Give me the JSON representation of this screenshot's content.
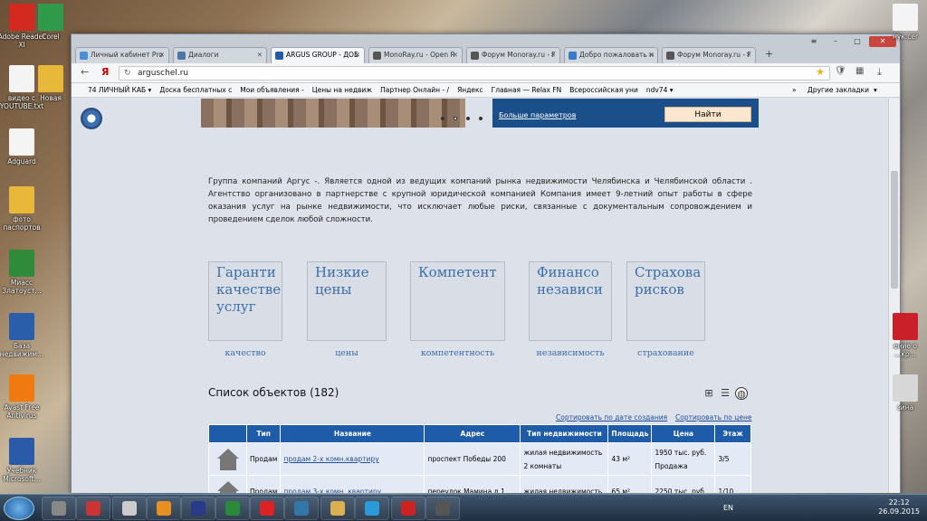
{
  "desktop": {
    "icons_left": [
      {
        "label": "Adobe Reader XI",
        "color": "#d32a1f"
      },
      {
        "label": "видео с YOUTUBE.txt",
        "color": "#f4f4f4"
      },
      {
        "label": "Adguard",
        "color": "#f4f4f4"
      },
      {
        "label": "фото паспортов",
        "color": "#e8b83a"
      },
      {
        "label": "Миасс Златоуст...",
        "color": "#2f8a3a"
      },
      {
        "label": "База недвижим...",
        "color": "#2a5ea8"
      },
      {
        "label": "Avast Free Antivirus",
        "color": "#f07a12"
      },
      {
        "label": "Учебник Microsoft...",
        "color": "#2b5aa8"
      }
    ],
    "icons_col2": [
      {
        "label": "Corel",
        "color": "#2f9a4a"
      },
      {
        "label": "Новая",
        "color": "#e8b83a"
      }
    ],
    "icons_right": [
      {
        "label": "нук.cer",
        "color": "#f4f4f4"
      },
      {
        "label": "ение о ...кр...",
        "color": "#c9202a"
      },
      {
        "label": "зина",
        "color": "#d7d7d7"
      }
    ]
  },
  "browser": {
    "tabs": [
      {
        "label": "Личный кабинет Pro",
        "color": "#4a8fd8",
        "active": false
      },
      {
        "label": "Диалоги",
        "color": "#4a76a8",
        "active": false
      },
      {
        "label": "ARGUS GROUP - ДОБ",
        "color": "#1e5ba8",
        "active": true
      },
      {
        "label": "MonoRay.ru - Open R",
        "color": "#555555",
        "active": false
      },
      {
        "label": "Форум Monoray.ru - F",
        "color": "#555555",
        "active": false
      },
      {
        "label": "Добро пожаловать н",
        "color": "#3a7ac8",
        "active": false
      },
      {
        "label": "Форум Monoray.ru - F",
        "color": "#555555",
        "active": false
      }
    ],
    "tab_close": "✕",
    "new_tab": "+",
    "window_buttons": {
      "menu": "≡",
      "minimize": "–",
      "maximize": "□",
      "close": "✕"
    },
    "address": "arguschel.ru",
    "yandex_label": "Я",
    "bookmarks": [
      "74 ЛИЧНЫЙ КАБ ▾",
      "Доска бесплатных с",
      "Мои объявления -",
      "Цены на недвиж",
      "Партнер Онлайн - /",
      "Яндекс",
      "Главная — Relax FN",
      "Всероссийская уни",
      "ndv74 ▾"
    ],
    "bookmarks_more": "»",
    "other_bookmarks": "Другие закладки",
    "other_bookmarks_arrow": "▾"
  },
  "page": {
    "search": {
      "more_params": "Больше параметров",
      "find_button": "Найти"
    },
    "about_text": "Группа компаний Аргус -. Является одной из ведущих компаний рынка недвижимости Челябинска и Челябинской области . Агентство организовано в партнерстве с крупной юридической компанией Компания имеет 9-летний опыт работы в сфере оказания услуг на рынке недвижимости, что исключает любые риски, связанные с документальным сопровождением и проведением сделок любой сложности.",
    "features": [
      {
        "alt": "Гаранти качестве услуг",
        "caption": "качество"
      },
      {
        "alt": "Низкие цены",
        "caption": "цены"
      },
      {
        "alt": "Компетент",
        "caption": "компетентность"
      },
      {
        "alt": "Финансо независи",
        "caption": "независимость"
      },
      {
        "alt": "Страхова рисков",
        "caption": "страхование"
      }
    ],
    "list_title": "Список объектов (182)",
    "sort_by_date": "Сортировать по дате создания",
    "sort_by_price": "Сортировать по цене",
    "table": {
      "headers": [
        "Тип",
        "Название",
        "Адрес",
        "Тип недвижимости",
        "Площадь",
        "Цена",
        "Этаж"
      ],
      "rows": [
        {
          "type": "Продам",
          "name": "продам 2-х комн.квартиру",
          "address": "проспект Победы 200",
          "realty_type": "жилая недвижимость",
          "rooms": "2 комнаты",
          "area": "43 м²",
          "price": "1950 тыс. руб.",
          "deal": "Продажа",
          "floor": "3/5"
        },
        {
          "type": "Продам",
          "name": "продам 3-х комн. квартиру",
          "address": "переулок Мамина д.1",
          "realty_type": "жилая недвижимость",
          "rooms": "",
          "area": "65 м²",
          "price": "2250 тыс. руб.",
          "deal": "",
          "floor": "1/10"
        }
      ]
    }
  },
  "taskbar": {
    "lang": "EN",
    "time": "22:12",
    "date": "26.09.2015"
  }
}
